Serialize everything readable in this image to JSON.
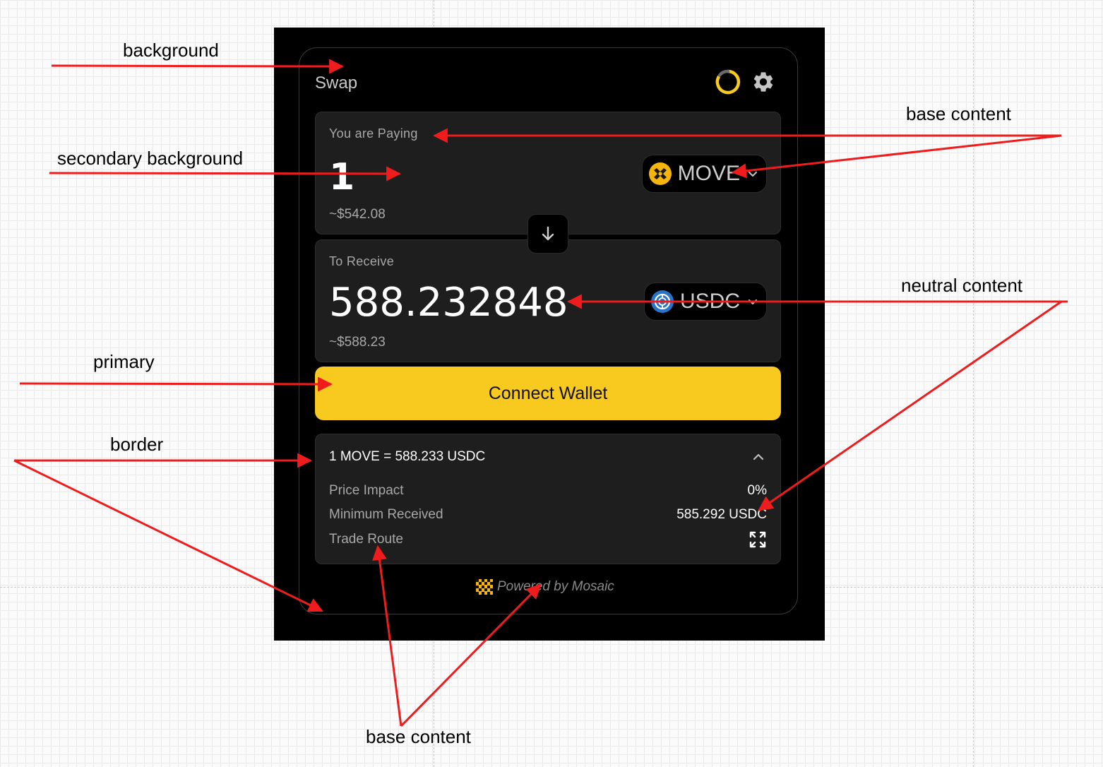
{
  "widget": {
    "title": "Swap",
    "pay": {
      "label": "You are Paying",
      "amount": "1",
      "usd": "~$542.08",
      "token": "MOVE"
    },
    "receive": {
      "label": "To Receive",
      "amount": "588.232848",
      "usd": "~$588.23",
      "token": "USDC"
    },
    "connect_label": "Connect Wallet",
    "details": {
      "rate": "1 MOVE = 588.233 USDC",
      "rows": [
        {
          "label": "Price Impact",
          "value": "0%"
        },
        {
          "label": "Minimum Received",
          "value": "585.292 USDC"
        },
        {
          "label": "Trade Route",
          "value": ""
        }
      ]
    },
    "powered_by": "Powered by Mosaic"
  },
  "annotations": {
    "background": "background",
    "secondary_background": "secondary background",
    "primary": "primary",
    "border": "border",
    "base_content_top": "base content",
    "neutral_content": "neutral content",
    "base_content_bottom": "base content"
  },
  "colors": {
    "primary": "#f8c91f",
    "background": "#000000",
    "secondary_background": "#1e1e1e",
    "border": "#3a3a3a",
    "annotation_arrow": "#ee1c1c"
  },
  "icons": [
    "refresh-icon",
    "gear-icon",
    "move-token-icon",
    "chevron-down-icon",
    "usdc-token-icon",
    "arrow-down-icon",
    "chevron-up-icon",
    "expand-icon",
    "mosaic-logo-icon"
  ]
}
